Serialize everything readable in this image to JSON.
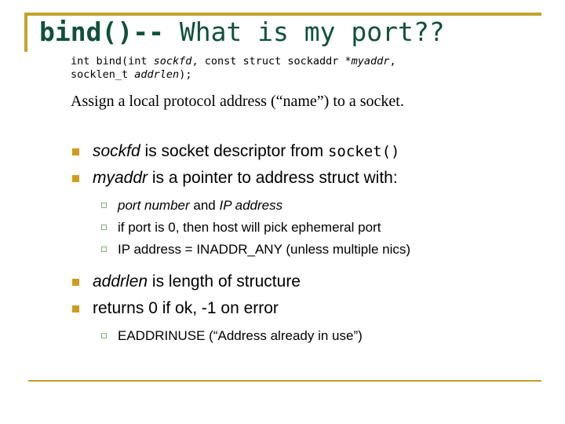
{
  "slide": {
    "title": {
      "primary": "bind()--",
      "secondary": "What is my port??"
    },
    "code_signature": {
      "line1_part1": "int bind(int ",
      "line1_param1": "sockfd",
      "line1_part2": ", const struct sockaddr *",
      "line1_param2": "myaddr",
      "line1_part3": ",",
      "line2_part1": "socklen_t ",
      "line2_param1": "addrlen",
      "line2_part2": ");"
    },
    "description": "Assign a local protocol address (“name”) to a socket.",
    "bullets": [
      {
        "level": 1,
        "marker": "filled-square-bullet",
        "segments": [
          {
            "text": "sockfd",
            "style": "italic"
          },
          {
            "text": " is socket descriptor from ",
            "style": "normal"
          },
          {
            "text": "socket()",
            "style": "mono"
          }
        ]
      },
      {
        "level": 1,
        "marker": "filled-square-bullet",
        "segments": [
          {
            "text": "myaddr",
            "style": "italic"
          },
          {
            "text": " is a pointer to address struct with:",
            "style": "normal"
          }
        ]
      },
      {
        "level": 2,
        "marker": "hollow-square-bullet",
        "segments": [
          {
            "text": "port number",
            "style": "italic"
          },
          {
            "text": " and ",
            "style": "normal"
          },
          {
            "text": "IP address",
            "style": "italic"
          }
        ]
      },
      {
        "level": 2,
        "marker": "hollow-square-bullet",
        "segments": [
          {
            "text": "if port is 0, then host will pick ephemeral port",
            "style": "normal"
          }
        ]
      },
      {
        "level": 2,
        "marker": "hollow-square-bullet",
        "segments": [
          {
            "text": "IP address = INADDR_ANY (unless multiple nics)",
            "style": "normal"
          }
        ]
      },
      {
        "level": 1,
        "marker": "filled-square-bullet",
        "segments": [
          {
            "text": "addrlen",
            "style": "italic"
          },
          {
            "text": " is length of structure",
            "style": "normal"
          }
        ]
      },
      {
        "level": 1,
        "marker": "filled-square-bullet",
        "segments": [
          {
            "text": "returns 0 if ok, -1 on error",
            "style": "normal"
          }
        ]
      },
      {
        "level": 2,
        "marker": "hollow-square-bullet",
        "segments": [
          {
            "text": "EADDRINUSE (“Address already in use”)",
            "style": "normal"
          }
        ]
      }
    ],
    "colors": {
      "title_green": "#10503c",
      "frame_gold": "#c2a32b",
      "bullet_gold": "#d09b1d",
      "subbullet_green": "#8aa97f",
      "background": "#ffffff",
      "body_text": "#000000"
    }
  }
}
